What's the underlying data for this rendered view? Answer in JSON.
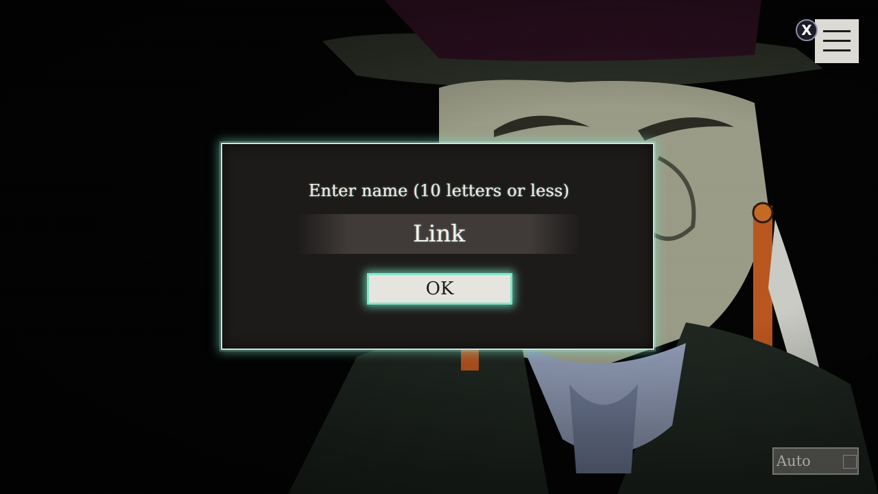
{
  "dialog": {
    "prompt": "Enter name (10 letters or less)",
    "name_value": "Link",
    "ok_label": "OK"
  },
  "controls": {
    "close_label": "X",
    "menu_icon": "hamburger-menu-icon",
    "auto_label": "Auto",
    "auto_enabled": false
  },
  "colors": {
    "dialog_bg": "#1d1b1a",
    "dialog_glow": "#7fe7c9",
    "button_bg": "#e6e4df",
    "text": "#f1efe9"
  }
}
